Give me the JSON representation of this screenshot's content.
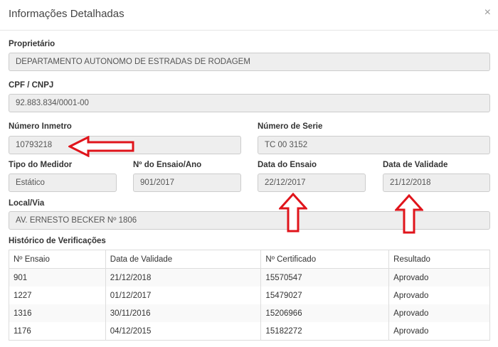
{
  "modal": {
    "title": "Informações Detalhadas",
    "close_icon": "×"
  },
  "fields": {
    "proprietario": {
      "label": "Proprietário",
      "value": "DEPARTAMENTO AUTONOMO DE ESTRADAS DE RODAGEM"
    },
    "cpf_cnpj": {
      "label": "CPF / CNPJ",
      "value": "92.883.834/0001-00"
    },
    "numero_inmetro": {
      "label": "Número Inmetro",
      "value": "10793218"
    },
    "numero_serie": {
      "label": "Número de Serie",
      "value": "TC 00 3152"
    },
    "tipo_medidor": {
      "label": "Tipo do Medidor",
      "value": "Estático"
    },
    "ensaio_ano": {
      "label": "Nº do Ensaio/Ano",
      "value": "901/2017"
    },
    "data_ensaio": {
      "label": "Data do Ensaio",
      "value": "22/12/2017"
    },
    "data_validade": {
      "label": "Data de Validade",
      "value": "21/12/2018"
    },
    "local_via": {
      "label": "Local/Via",
      "value": "AV. ERNESTO BECKER Nº 1806"
    }
  },
  "historico": {
    "title": "Histórico de Verificações",
    "columns": [
      "Nº Ensaio",
      "Data de Validade",
      "Nº Certificado",
      "Resultado"
    ],
    "rows": [
      [
        "901",
        "21/12/2018",
        "15570547",
        "Aprovado"
      ],
      [
        "1227",
        "01/12/2017",
        "15479027",
        "Aprovado"
      ],
      [
        "1316",
        "30/11/2016",
        "15206966",
        "Aprovado"
      ],
      [
        "1176",
        "04/12/2015",
        "15182272",
        "Aprovado"
      ]
    ]
  },
  "annotations": {
    "arrow_color": "#e0141b"
  }
}
